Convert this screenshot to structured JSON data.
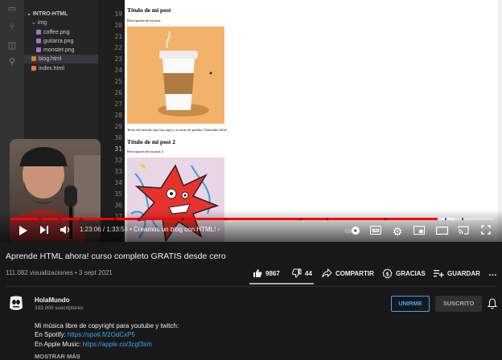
{
  "editor": {
    "folder": "INTRO-HTML",
    "subfolder": "img",
    "files": [
      "coffee.png",
      "guitarra.png",
      "monster.png",
      "blog.html",
      "index.html"
    ],
    "line_numbers": [
      "19",
      "20",
      "21",
      "22",
      "23",
      "24",
      "25",
      "26",
      "27",
      "28",
      "29",
      "30",
      "31",
      "32",
      "33",
      "34",
      "35",
      "36",
      "37"
    ],
    "active_line": "31"
  },
  "browser": {
    "post1_title": "Título de mi post",
    "post1_desc": "Descripción de mi post",
    "post1_body": "Texto del artículo que hay aquí y es texto de prueba. Chanchito feliz!",
    "post2_title": "Título de mi post 2",
    "post2_desc": "Descripción de mi post 2"
  },
  "player": {
    "time": "1:23:06 / 1:33:54",
    "chapter": "• Creamos un blog con HTML!",
    "progress": 0.885,
    "buffered": 0.92,
    "chapter_marks": [
      0.06,
      0.1,
      0.145,
      0.215,
      0.265,
      0.355,
      0.445,
      0.6,
      0.655,
      0.775,
      0.9,
      0.935
    ],
    "accent": "#ff0000",
    "icons": [
      "play-icon",
      "next-icon",
      "volume-icon",
      "autoplay-toggle-icon",
      "subtitles-icon",
      "settings-icon",
      "miniplayer-icon",
      "theater-icon",
      "cast-icon",
      "fullscreen-icon"
    ]
  },
  "video": {
    "title": "Aprende HTML ahora! curso completo GRATIS desde cero",
    "views": "111.082 visualizaciones",
    "date": "• 3 sept 2021",
    "likes": "9867",
    "dislikes": "44",
    "share": "COMPARTIR",
    "thanks": "GRACIAS",
    "save": "GUARDAR",
    "more": "…"
  },
  "channel": {
    "name": "HolaMundo",
    "subscribers": "332.000 suscriptores",
    "join": "UNIRME",
    "subscribed": "SUSCRITO",
    "link_color": "#3ea6ff"
  },
  "description": {
    "line1": "Mi música libre de copyright para youtube y twitch:",
    "spotify_label": "En Spotify:",
    "spotify_url": "https://spoti.fi/2OdCxP5",
    "apple_label": "En Apple Music:",
    "apple_url": "https://apple.co/3cgl3sm",
    "show_more": "MOSTRAR MÁS"
  }
}
